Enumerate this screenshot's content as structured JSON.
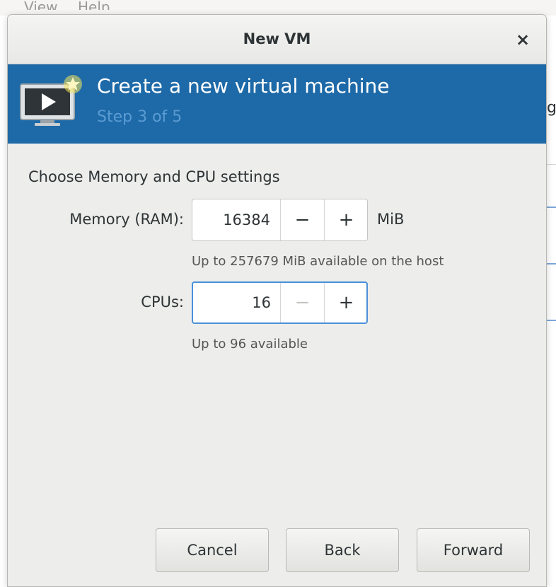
{
  "background_app": {
    "menu": [
      "View",
      "Help"
    ],
    "right_edge_text": "ge"
  },
  "dialog": {
    "title": "New VM",
    "close_glyph": "×"
  },
  "banner": {
    "title": "Create a new virtual machine",
    "step": "Step 3 of 5"
  },
  "form": {
    "section_title": "Choose Memory and CPU settings",
    "memory": {
      "label": "Memory (RAM):",
      "value": "16384",
      "unit": "MiB",
      "hint": "Up to 257679 MiB available on the host",
      "minus_enabled": true,
      "plus_enabled": true
    },
    "cpus": {
      "label": "CPUs:",
      "value": "16",
      "hint": "Up to 96 available",
      "minus_enabled": false,
      "plus_enabled": true
    },
    "minus_glyph": "−",
    "plus_glyph": "+"
  },
  "footer": {
    "cancel_label": "Cancel",
    "back_label": "Back",
    "forward_label": "Forward"
  },
  "colors": {
    "banner": "#1e6aa8",
    "banner_subtitle": "#5a9bd3",
    "focus": "#4a90d9",
    "dialog_bg": "#ededeb"
  },
  "icons": {
    "banner": "vm-screen-new-icon",
    "close": "close-icon"
  }
}
